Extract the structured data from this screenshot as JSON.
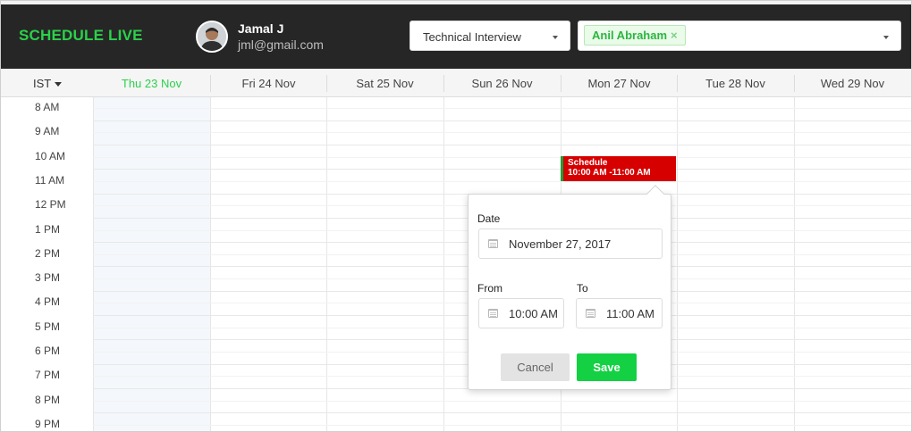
{
  "header": {
    "brand": "SCHEDULE LIVE",
    "user": {
      "name": "Jamal J",
      "email": "jml@gmail.com"
    },
    "interview_type": {
      "selected": "Technical Interview"
    },
    "interviewers": {
      "tags": [
        {
          "label": "Anil Abraham",
          "remove": "×"
        }
      ]
    }
  },
  "calendar": {
    "timezone": "IST",
    "days": [
      {
        "label": "Thu 23 Nov",
        "active": true
      },
      {
        "label": "Fri 24 Nov",
        "active": false
      },
      {
        "label": "Sat 25 Nov",
        "active": false
      },
      {
        "label": "Sun 26 Nov",
        "active": false
      },
      {
        "label": "Mon 27 Nov",
        "active": false
      },
      {
        "label": "Tue 28 Nov",
        "active": false
      },
      {
        "label": "Wed 29 Nov",
        "active": false
      }
    ],
    "hours": [
      "8 AM",
      "9 AM",
      "10 AM",
      "11 AM",
      "12 PM",
      "1 PM",
      "2 PM",
      "3 PM",
      "4 PM",
      "5 PM",
      "6 PM",
      "7 PM",
      "8 PM",
      "9 PM"
    ],
    "event": {
      "title": "Schedule",
      "time": "10:00 AM -11:00 AM"
    }
  },
  "popover": {
    "date_label": "Date",
    "date_value": "November 27, 2017",
    "from_label": "From",
    "from_value": "10:00 AM",
    "to_label": "To",
    "to_value": "11:00 AM",
    "cancel_label": "Cancel",
    "save_label": "Save"
  },
  "colors": {
    "accent": "#2bd14a",
    "header_bg": "#262626",
    "event_bg": "#d60000",
    "save_bg": "#13d143"
  }
}
